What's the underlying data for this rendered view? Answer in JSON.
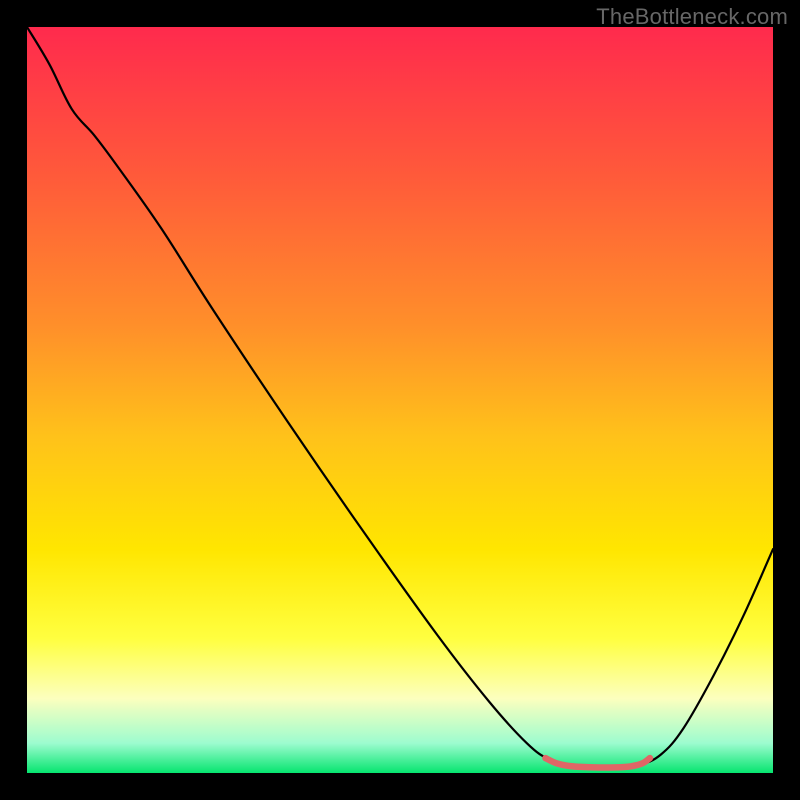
{
  "watermark": "TheBottleneck.com",
  "chart_data": {
    "type": "line",
    "title": "",
    "xlabel": "",
    "ylabel": "",
    "x_range": [
      0,
      100
    ],
    "y_range": [
      0,
      100
    ],
    "gradient_stops": [
      {
        "offset": 0.0,
        "color": "#ff2a4d"
      },
      {
        "offset": 0.2,
        "color": "#ff5a3a"
      },
      {
        "offset": 0.4,
        "color": "#ff8f2a"
      },
      {
        "offset": 0.55,
        "color": "#ffc21a"
      },
      {
        "offset": 0.7,
        "color": "#ffe600"
      },
      {
        "offset": 0.82,
        "color": "#ffff40"
      },
      {
        "offset": 0.9,
        "color": "#fcffbe"
      },
      {
        "offset": 0.96,
        "color": "#9dfccf"
      },
      {
        "offset": 1.0,
        "color": "#06e56f"
      }
    ],
    "series": [
      {
        "name": "bottleneck-curve",
        "color": "#000000",
        "width": 2.2,
        "data": [
          {
            "x": 0.0,
            "y": 100.0
          },
          {
            "x": 3.0,
            "y": 95.0
          },
          {
            "x": 6.0,
            "y": 89.0
          },
          {
            "x": 9.0,
            "y": 85.5
          },
          {
            "x": 12.0,
            "y": 81.5
          },
          {
            "x": 18.0,
            "y": 73.0
          },
          {
            "x": 25.0,
            "y": 62.0
          },
          {
            "x": 35.0,
            "y": 47.0
          },
          {
            "x": 45.0,
            "y": 32.5
          },
          {
            "x": 55.0,
            "y": 18.5
          },
          {
            "x": 62.0,
            "y": 9.5
          },
          {
            "x": 67.0,
            "y": 4.0
          },
          {
            "x": 70.0,
            "y": 1.8
          },
          {
            "x": 73.0,
            "y": 0.9
          },
          {
            "x": 76.0,
            "y": 0.7
          },
          {
            "x": 79.0,
            "y": 0.7
          },
          {
            "x": 82.0,
            "y": 1.0
          },
          {
            "x": 85.0,
            "y": 2.5
          },
          {
            "x": 88.0,
            "y": 6.0
          },
          {
            "x": 92.0,
            "y": 13.0
          },
          {
            "x": 96.0,
            "y": 21.0
          },
          {
            "x": 100.0,
            "y": 30.0
          }
        ]
      },
      {
        "name": "optimal-zone",
        "color": "#e06666",
        "width": 6.5,
        "data": [
          {
            "x": 69.5,
            "y": 2.0
          },
          {
            "x": 71.0,
            "y": 1.3
          },
          {
            "x": 73.0,
            "y": 0.9
          },
          {
            "x": 76.0,
            "y": 0.75
          },
          {
            "x": 79.0,
            "y": 0.75
          },
          {
            "x": 81.0,
            "y": 0.9
          },
          {
            "x": 82.5,
            "y": 1.3
          },
          {
            "x": 83.5,
            "y": 2.0
          }
        ]
      }
    ]
  }
}
